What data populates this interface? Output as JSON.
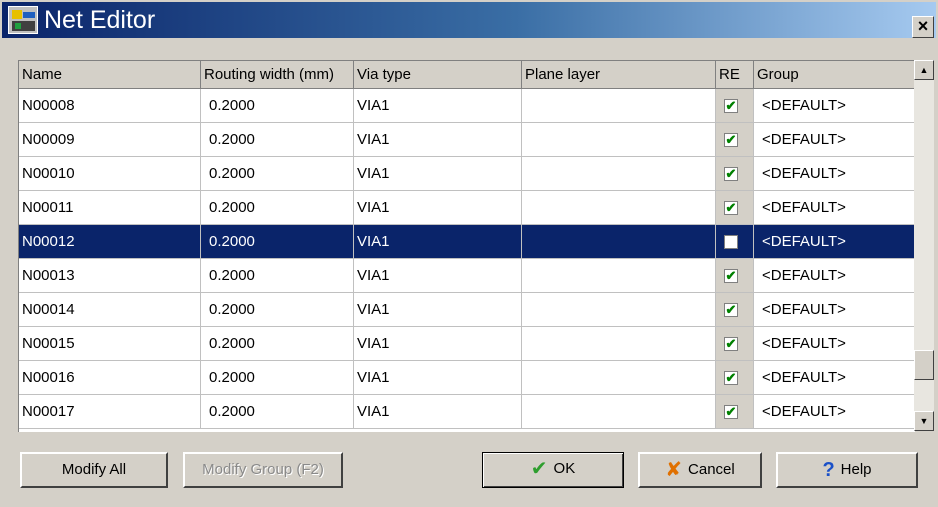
{
  "window": {
    "title": "Net Editor",
    "close_symbol": "×"
  },
  "table": {
    "columns": [
      "Name",
      "Routing width (mm)",
      "Via type",
      "Plane layer",
      "RE",
      "Group"
    ],
    "rows": [
      {
        "name": "N00008",
        "width": "0.2000",
        "via": "VIA1",
        "plane": "",
        "re": true,
        "group": "<DEFAULT>"
      },
      {
        "name": "N00009",
        "width": "0.2000",
        "via": "VIA1",
        "plane": "",
        "re": true,
        "group": "<DEFAULT>"
      },
      {
        "name": "N00010",
        "width": "0.2000",
        "via": "VIA1",
        "plane": "",
        "re": true,
        "group": "<DEFAULT>"
      },
      {
        "name": "N00011",
        "width": "0.2000",
        "via": "VIA1",
        "plane": "",
        "re": true,
        "group": "<DEFAULT>"
      },
      {
        "name": "N00012",
        "width": "0.2000",
        "via": "VIA1",
        "plane": "",
        "re": false,
        "group": "<DEFAULT>",
        "selected": true
      },
      {
        "name": "N00013",
        "width": "0.2000",
        "via": "VIA1",
        "plane": "",
        "re": true,
        "group": "<DEFAULT>"
      },
      {
        "name": "N00014",
        "width": "0.2000",
        "via": "VIA1",
        "plane": "",
        "re": true,
        "group": "<DEFAULT>"
      },
      {
        "name": "N00015",
        "width": "0.2000",
        "via": "VIA1",
        "plane": "",
        "re": true,
        "group": "<DEFAULT>"
      },
      {
        "name": "N00016",
        "width": "0.2000",
        "via": "VIA1",
        "plane": "",
        "re": true,
        "group": "<DEFAULT>"
      },
      {
        "name": "N00017",
        "width": "0.2000",
        "via": "VIA1",
        "plane": "",
        "re": true,
        "group": "<DEFAULT>"
      }
    ]
  },
  "buttons": {
    "modify_all": "Modify All",
    "modify_group": "Modify Group (F2)",
    "ok": "OK",
    "ok_icon": "✔",
    "cancel": "Cancel",
    "cancel_icon": "✘",
    "help": "Help",
    "help_icon": "?"
  },
  "colors": {
    "selection": "#0a246a",
    "check": "#008000",
    "ok_icon": "#2e9e2e",
    "cancel_icon": "#e07000",
    "help_icon": "#1a50c8"
  }
}
